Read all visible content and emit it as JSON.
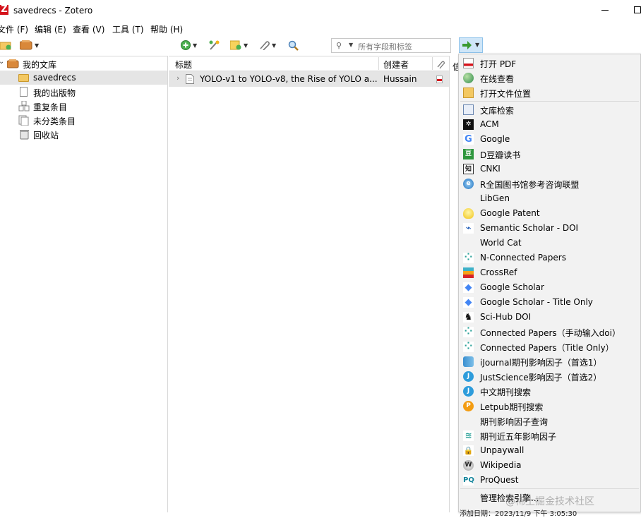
{
  "window": {
    "title": "savedrecs - Zotero",
    "logo_letter": "Z"
  },
  "menubar": {
    "items": [
      {
        "label": "文件 (F)"
      },
      {
        "label": "编辑 (E)"
      },
      {
        "label": "查看 (V)"
      },
      {
        "label": "工具 (T)"
      },
      {
        "label": "帮助 (H)"
      }
    ]
  },
  "toolbar": {
    "search_placeholder": "所有字段和标签",
    "icons": [
      "new-collection-icon",
      "new-library-icon",
      "new-item-icon",
      "add-by-identifier-icon",
      "new-note-icon",
      "attachment-icon",
      "advanced-search-icon",
      "locate-icon"
    ]
  },
  "collections": {
    "library_label": "我的文库",
    "items": [
      {
        "label": "savedrecs",
        "icon": "folder-icon",
        "selected": true
      },
      {
        "label": "我的出版物",
        "icon": "publications-icon"
      },
      {
        "label": "重复条目",
        "icon": "duplicates-icon"
      },
      {
        "label": "未分类条目",
        "icon": "unfiled-icon"
      },
      {
        "label": "回收站",
        "icon": "trash-icon"
      }
    ]
  },
  "items_table": {
    "columns": [
      {
        "label": "标题"
      },
      {
        "label": "创建者"
      }
    ],
    "rows": [
      {
        "title": "YOLO-v1 to YOLO-v8, the Rise of YOLO a...",
        "creator": "Hussain"
      }
    ]
  },
  "info_pane": {
    "tab_partial": "信"
  },
  "locate_menu": {
    "groups": [
      [
        {
          "label": "打开 PDF",
          "icon": "pdf-icon"
        },
        {
          "label": "在线查看",
          "icon": "globe-icon"
        },
        {
          "label": "打开文件位置",
          "icon": "folder-icon"
        }
      ],
      [
        {
          "label": "文库检索",
          "icon": "library-lookup-icon"
        },
        {
          "label": "ACM",
          "icon": "acm-icon"
        },
        {
          "label": "Google",
          "icon": "google-icon"
        },
        {
          "label": "D豆瓣读书",
          "icon": "douban-icon"
        },
        {
          "label": "CNKI",
          "icon": "cnki-icon"
        },
        {
          "label": "R全国图书馆参考咨询联盟",
          "icon": "ie-icon"
        },
        {
          "label": "LibGen",
          "icon": ""
        },
        {
          "label": "Google Patent",
          "icon": "lightbulb-icon"
        },
        {
          "label": "Semantic Scholar - DOI",
          "icon": "semantic-scholar-icon"
        },
        {
          "label": "World Cat",
          "icon": ""
        },
        {
          "label": "N-Connected Papers",
          "icon": "connected-papers-icon"
        },
        {
          "label": "CrossRef",
          "icon": "crossref-icon"
        },
        {
          "label": "Google Scholar",
          "icon": "scholar-cap-icon"
        },
        {
          "label": "Google Scholar - Title Only",
          "icon": "scholar-cap-icon"
        },
        {
          "label": "Sci-Hub DOI",
          "icon": "raven-icon"
        },
        {
          "label": "Connected Papers（手动输入doi）",
          "icon": "connected-papers-icon"
        },
        {
          "label": "Connected Papers（Title Only）",
          "icon": "connected-papers-icon"
        },
        {
          "label": "iJournal期刊影响因子（首选1）",
          "icon": "ijournal-icon"
        },
        {
          "label": "JustScience影响因子（首选2）",
          "icon": "justscience-icon"
        },
        {
          "label": "中文期刊搜索",
          "icon": "justscience-icon"
        },
        {
          "label": "Letpub期刊搜索",
          "icon": "letpub-icon"
        },
        {
          "label": "期刊影响因子查询",
          "icon": ""
        },
        {
          "label": "期刊近五年影响因子",
          "icon": "wave-icon"
        },
        {
          "label": "Unpaywall",
          "icon": "lock-icon"
        },
        {
          "label": "Wikipedia",
          "icon": "wikipedia-icon"
        },
        {
          "label": "ProQuest",
          "icon": "proquest-icon"
        }
      ],
      [
        {
          "label": "管理检索引擎...",
          "icon": ""
        }
      ]
    ]
  },
  "watermark": "@稀土掘金技术社区",
  "status_fragment": "添加日期：2023/11/9 下午 3:05:30",
  "colors": {
    "accent": "#cfe6f8",
    "selection": "#e5e5e5",
    "logo": "#d4121a"
  }
}
